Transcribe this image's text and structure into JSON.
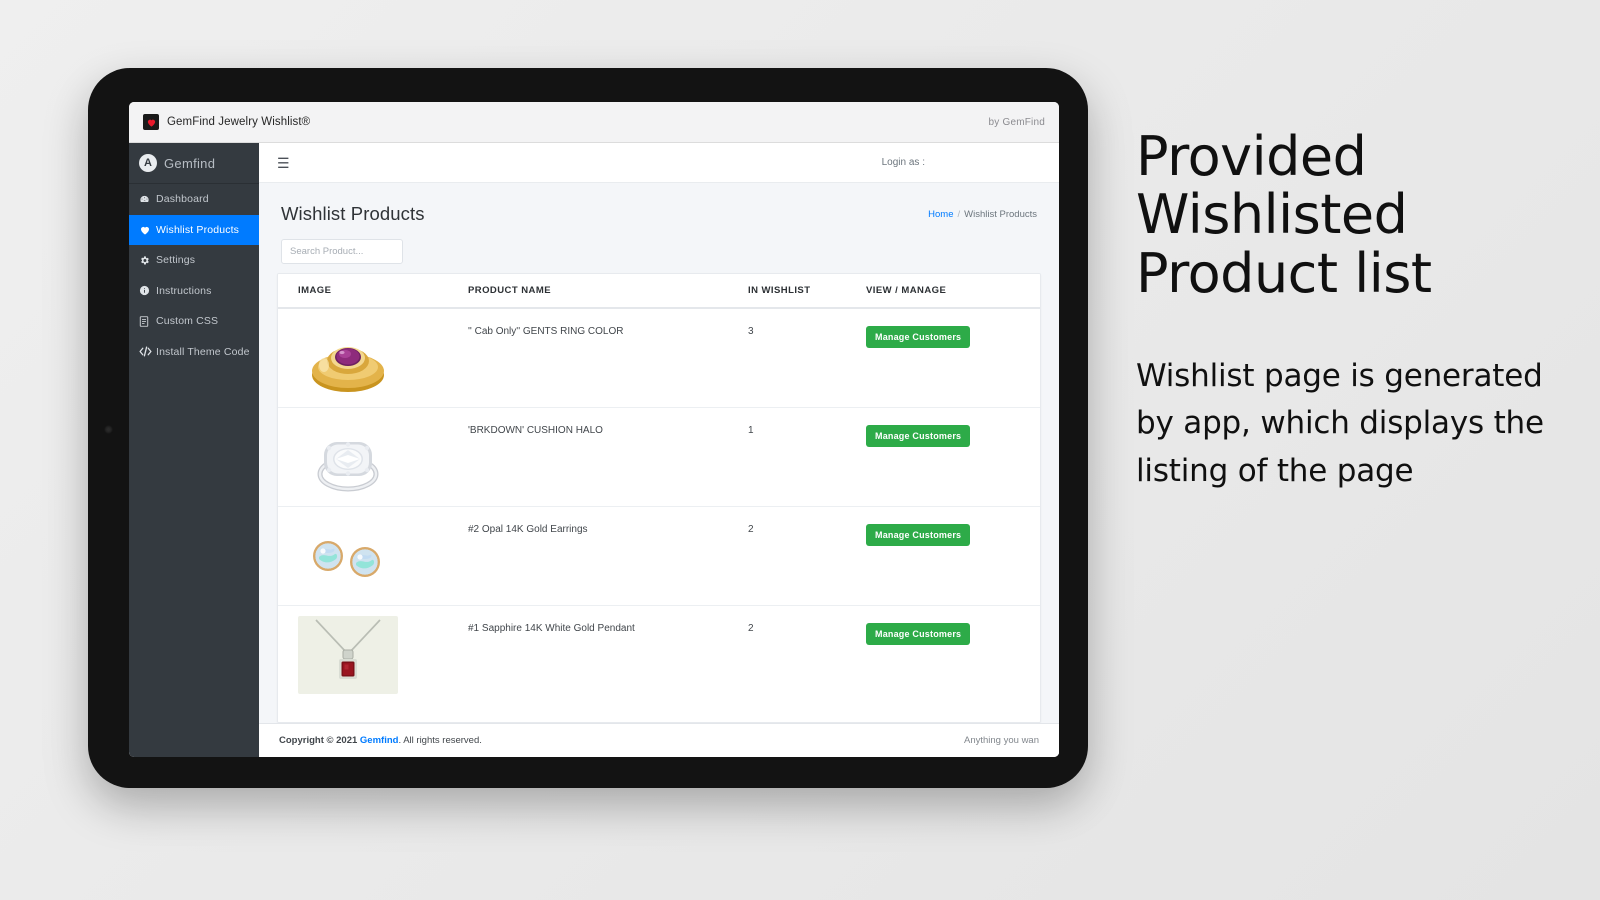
{
  "browser": {
    "tab_title": "GemFind Jewelry Wishlist®",
    "favicon_icon": "heart-icon",
    "by_label": "by GemFind"
  },
  "sidebar": {
    "brand": {
      "mark": "A",
      "label": "Gemfind",
      "icon": "gemfind-logo-icon"
    },
    "items": [
      {
        "label": "Dashboard",
        "icon": "dashboard-icon",
        "active": false
      },
      {
        "label": "Wishlist Products",
        "icon": "heart-icon",
        "active": true
      },
      {
        "label": "Settings",
        "icon": "gear-icon",
        "active": false
      },
      {
        "label": "Instructions",
        "icon": "info-icon",
        "active": false
      },
      {
        "label": "Custom CSS",
        "icon": "css-file-icon",
        "active": false
      },
      {
        "label": "Install Theme Code",
        "icon": "code-icon",
        "active": false
      }
    ]
  },
  "topbar": {
    "menu_icon": "hamburger-icon",
    "login_as": "Login as :"
  },
  "page": {
    "title": "Wishlist Products",
    "breadcrumb": {
      "home": "Home",
      "separator": "/",
      "current": "Wishlist Products"
    }
  },
  "search": {
    "placeholder": "Search Product...",
    "value": ""
  },
  "table": {
    "columns": [
      "IMAGE",
      "PRODUCT NAME",
      "IN WISHLIST",
      "VIEW / MANAGE"
    ],
    "rows": [
      {
        "image_alt": "gold ring with purple amethyst gemstone",
        "product_name": "'' Cab Only'' GENTS RING COLOR",
        "in_wishlist": "3",
        "action_label": "Manage Customers"
      },
      {
        "image_alt": "white gold cushion halo diamond ring",
        "product_name": "'BRKDOWN' CUSHION HALO",
        "in_wishlist": "1",
        "action_label": "Manage Customers"
      },
      {
        "image_alt": "pair of opal stud earrings",
        "product_name": "#2 Opal 14K Gold Earrings",
        "in_wishlist": "2",
        "action_label": "Manage Customers"
      },
      {
        "image_alt": "garnet pendant on silver chain",
        "product_name": "#1 Sapphire 14K White Gold Pendant",
        "in_wishlist": "2",
        "action_label": "Manage Customers"
      }
    ]
  },
  "footer": {
    "copyright_prefix": "Copyright © 2021 ",
    "brand": "Gemfind",
    "copyright_suffix": ". All rights reserved.",
    "right": "Anything you wan"
  },
  "annotation": {
    "heading": "Provided Wishlisted Product list",
    "body": "Wishlist page is generated by app, which displays the listing of the page"
  },
  "colors": {
    "sidebar_bg": "#343a40",
    "active_nav": "#007bff",
    "link_blue": "#007bff",
    "button_green": "#2dab48",
    "page_bg": "#f4f6f9",
    "device_frame": "#131313"
  }
}
